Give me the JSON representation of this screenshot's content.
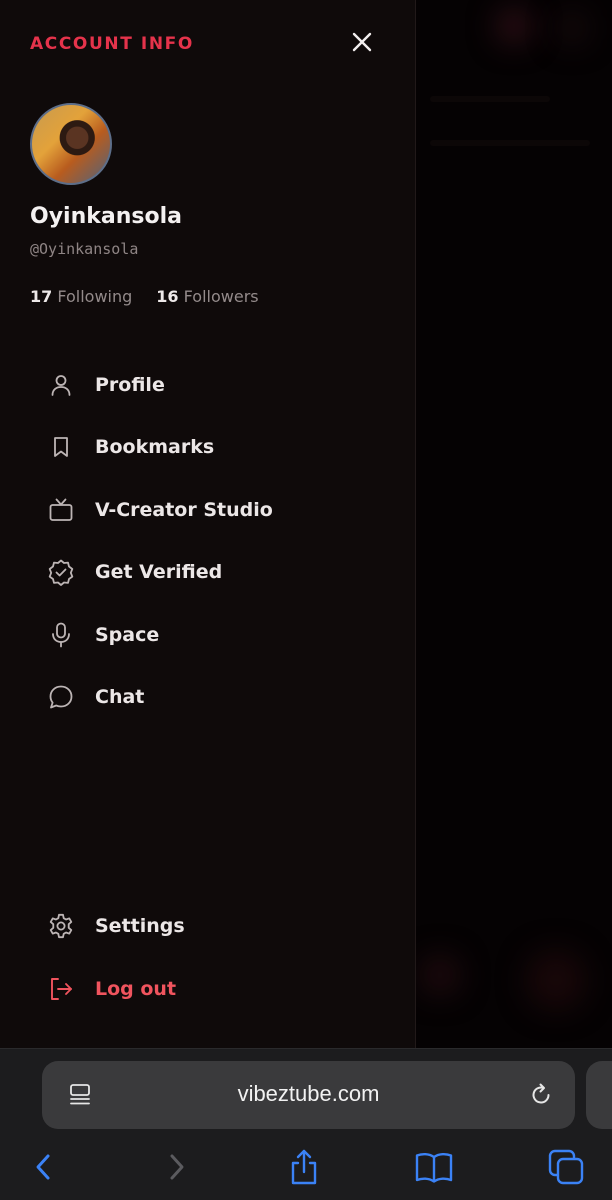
{
  "drawer": {
    "title": "ACCOUNT INFO",
    "close_icon": "close-icon"
  },
  "user": {
    "name": "Oyinkansola",
    "handle": "@Oyinkansola",
    "following_count": "17",
    "following_label": "Following",
    "followers_count": "16",
    "followers_label": "Followers"
  },
  "menu": [
    {
      "label": "Profile",
      "icon": "person-icon"
    },
    {
      "label": "Bookmarks",
      "icon": "bookmark-icon"
    },
    {
      "label": "V-Creator Studio",
      "icon": "tv-icon"
    },
    {
      "label": "Get Verified",
      "icon": "verified-badge-icon"
    },
    {
      "label": "Space",
      "icon": "microphone-icon"
    },
    {
      "label": "Chat",
      "icon": "chat-bubble-icon"
    }
  ],
  "footer_menu": [
    {
      "label": "Settings",
      "icon": "gear-icon"
    },
    {
      "label": "Log out",
      "icon": "logout-icon"
    }
  ],
  "browser": {
    "url": "vibeztube.com"
  },
  "colors": {
    "accent": "#e5334b",
    "logout": "#f0545e",
    "drawer_bg": "#0f0a0a",
    "ios_blue": "#3b82f6"
  }
}
